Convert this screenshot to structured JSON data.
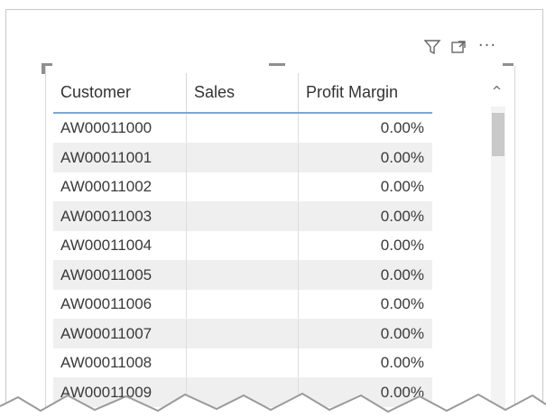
{
  "table": {
    "columns": [
      "Customer",
      "Sales",
      "Profit Margin"
    ],
    "rows": [
      {
        "customer": "AW00011000",
        "sales": "",
        "profit_margin": "0.00%"
      },
      {
        "customer": "AW00011001",
        "sales": "",
        "profit_margin": "0.00%"
      },
      {
        "customer": "AW00011002",
        "sales": "",
        "profit_margin": "0.00%"
      },
      {
        "customer": "AW00011003",
        "sales": "",
        "profit_margin": "0.00%"
      },
      {
        "customer": "AW00011004",
        "sales": "",
        "profit_margin": "0.00%"
      },
      {
        "customer": "AW00011005",
        "sales": "",
        "profit_margin": "0.00%"
      },
      {
        "customer": "AW00011006",
        "sales": "",
        "profit_margin": "0.00%"
      },
      {
        "customer": "AW00011007",
        "sales": "",
        "profit_margin": "0.00%"
      },
      {
        "customer": "AW00011008",
        "sales": "",
        "profit_margin": "0.00%"
      },
      {
        "customer": "AW00011009",
        "sales": "",
        "profit_margin": "0.00%"
      }
    ]
  },
  "header_icons": {
    "filter": "filter-icon",
    "focus": "focus-mode-icon",
    "more": "more-options-icon",
    "more_glyph": "···"
  },
  "scrollbar": {
    "up_glyph": "^"
  },
  "colors": {
    "header_border": "#76a9dc",
    "alt_row": "#efefef",
    "text": "#3a3a3a"
  }
}
